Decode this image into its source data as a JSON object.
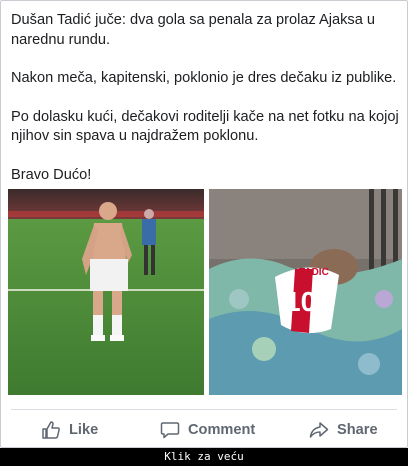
{
  "post": {
    "paragraphs": [
      "Dušan Tadić juče: dva gola sa penala za prolaz Ajaksa u narednu rundu.",
      "Nakon meča, kapitenski, poklonio je dres dečaku iz publike.",
      "Po dolasku kući, dečakovi roditelji kače na net fotku na kojoj njihov sin spava u najdražem poklonu.",
      "Bravo Dućo!"
    ]
  },
  "photos": {
    "shirt_text": "TADIC",
    "shirt_number": "10"
  },
  "actions": {
    "like": "Like",
    "comment": "Comment",
    "share": "Share"
  },
  "footer": {
    "label": "Klik za veću"
  },
  "colors": {
    "text": "#1c1e21",
    "action_text": "#606770",
    "ajax_red": "#c8102e",
    "pitch_green": "#4f8a3a"
  }
}
